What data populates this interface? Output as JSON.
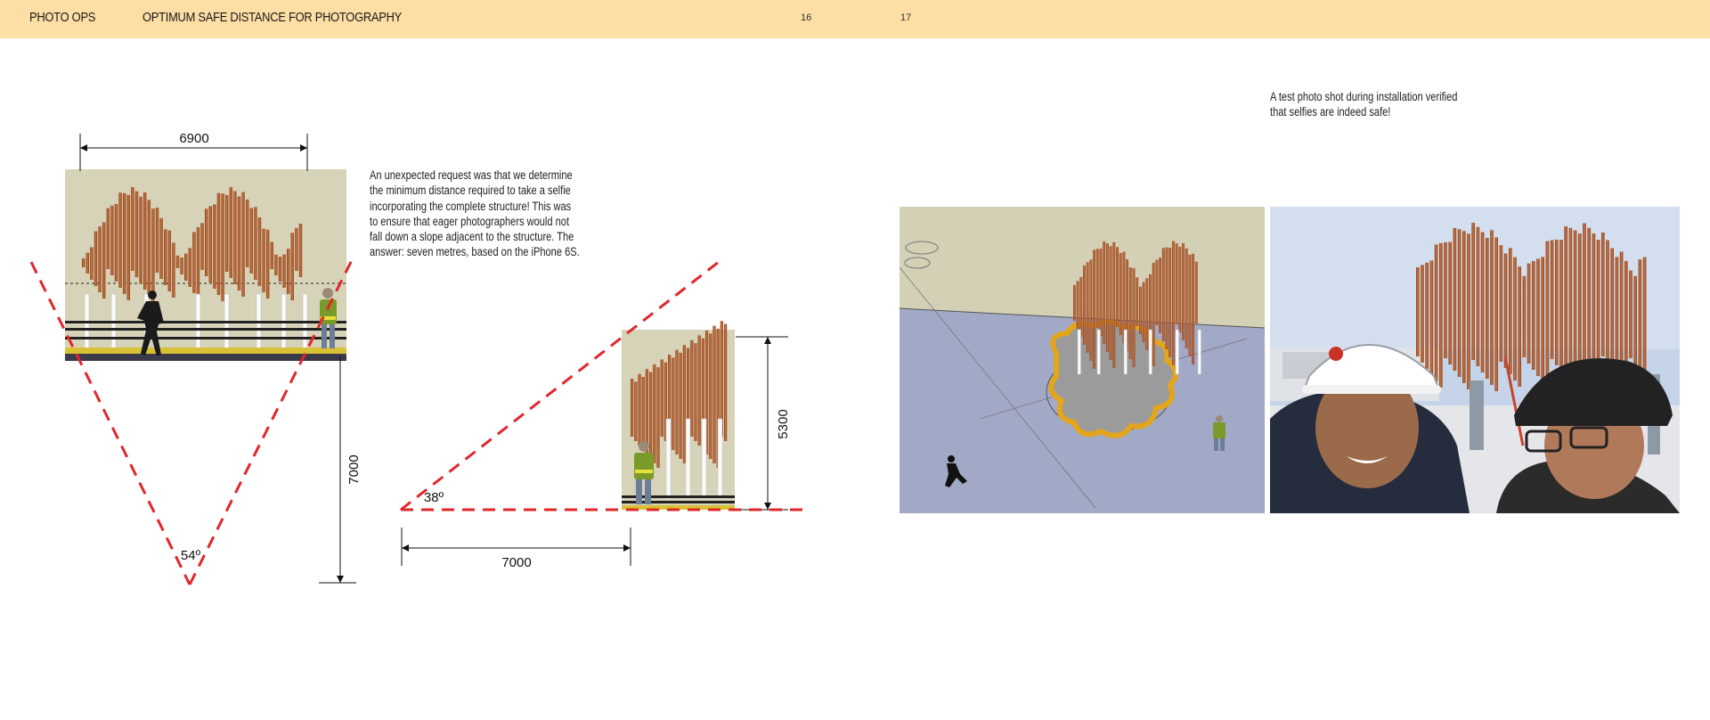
{
  "header": {
    "section": "PHOTO OPS",
    "title": "OPTIMUM SAFE DISTANCE FOR PHOTOGRAPHY",
    "page_left": "16",
    "page_right": "17"
  },
  "diagram": {
    "width_dim": "6900",
    "distance_dim_vertical": "7000",
    "distance_dim_horizontal": "7000",
    "height_dim": "5300",
    "angle_front": "54º",
    "angle_side": "38º"
  },
  "body_text": "An unexpected request was that we determine the minimum distance required to take a selfie incorporating the complete structure! This was to ensure that eager photographers would not fall down a slope adjacent to the structure. The answer: seven metres, based on the iPhone 6S.",
  "caption": "A test photo shot during installation verified that selfies are indeed safe!",
  "colors": {
    "header_bg": "#fddea5",
    "dashed_line": "#e0272b",
    "fin_copper": "#c86a36",
    "backdrop": "#d7d3b8"
  }
}
